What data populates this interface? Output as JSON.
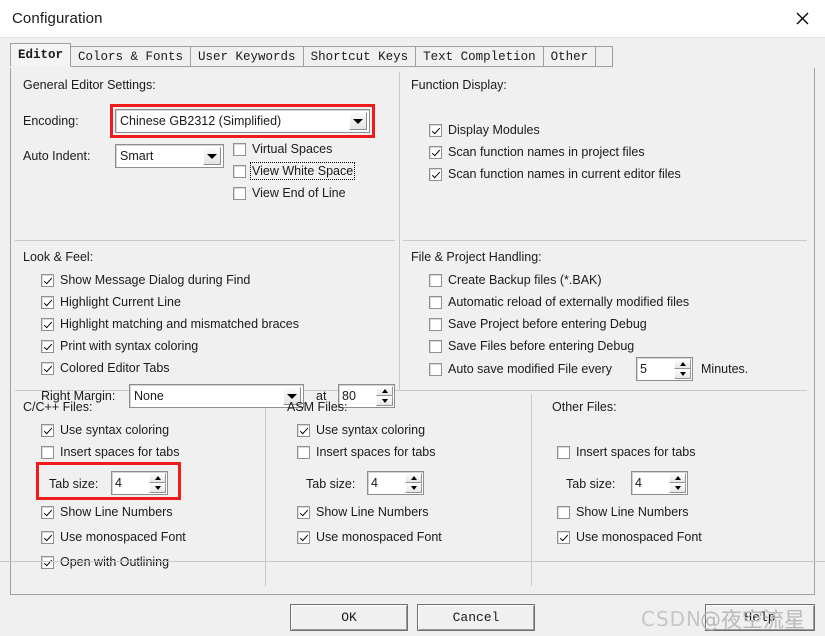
{
  "window": {
    "title": "Configuration",
    "close_icon": "close-icon"
  },
  "tabs": [
    {
      "label": "Editor",
      "selected": true
    },
    {
      "label": "Colors & Fonts",
      "selected": false
    },
    {
      "label": "User Keywords",
      "selected": false
    },
    {
      "label": "Shortcut Keys",
      "selected": false
    },
    {
      "label": "Text Completion",
      "selected": false
    },
    {
      "label": "Other",
      "selected": false
    }
  ],
  "general_editor": {
    "title": "General Editor Settings:",
    "encoding_label": "Encoding:",
    "encoding_value": "Chinese GB2312 (Simplified)",
    "auto_indent_label": "Auto Indent:",
    "auto_indent_value": "Smart",
    "checks": [
      {
        "label": "Virtual Spaces",
        "checked": false,
        "focused": false
      },
      {
        "label": "View White Space",
        "checked": false,
        "focused": true
      },
      {
        "label": "View End of Line",
        "checked": false,
        "focused": false
      }
    ]
  },
  "function_display": {
    "title": "Function Display:",
    "checks": [
      {
        "label": "Display Modules",
        "checked": true
      },
      {
        "label": "Scan function names in project files",
        "checked": true
      },
      {
        "label": "Scan function names in current editor files",
        "checked": true
      }
    ]
  },
  "look_feel": {
    "title": "Look & Feel:",
    "checks": [
      {
        "label": "Show Message Dialog during Find",
        "checked": true
      },
      {
        "label": "Highlight Current Line",
        "checked": true
      },
      {
        "label": "Highlight matching and mismatched braces",
        "checked": true
      },
      {
        "label": "Print with syntax coloring",
        "checked": true
      },
      {
        "label": "Colored Editor Tabs",
        "checked": true
      }
    ],
    "right_margin_label": "Right Margin:",
    "right_margin_value": "None",
    "at_label": "at",
    "at_value": "80"
  },
  "file_project": {
    "title": "File & Project Handling:",
    "checks": [
      {
        "label": "Create Backup files (*.BAK)",
        "checked": false
      },
      {
        "label": "Automatic reload of externally modified files",
        "checked": false
      },
      {
        "label": "Save Project before entering Debug",
        "checked": false
      },
      {
        "label": "Save Files before entering Debug",
        "checked": false
      },
      {
        "label": "Auto save modified File every",
        "checked": false
      }
    ],
    "autosave_value": "5",
    "minutes_label": "Minutes."
  },
  "cpp_files": {
    "title": "C/C++ Files:",
    "checks_top": [
      {
        "label": "Use syntax coloring",
        "checked": true
      },
      {
        "label": "Insert spaces for tabs",
        "checked": false
      }
    ],
    "tab_size_label": "Tab size:",
    "tab_size_value": "4",
    "checks_bottom": [
      {
        "label": "Show Line Numbers",
        "checked": true
      },
      {
        "label": "Use monospaced Font",
        "checked": true
      },
      {
        "label": "Open with Outlining",
        "checked": true
      }
    ]
  },
  "asm_files": {
    "title": "ASM Files:",
    "checks_top": [
      {
        "label": "Use syntax coloring",
        "checked": true
      },
      {
        "label": "Insert spaces for tabs",
        "checked": false
      }
    ],
    "tab_size_label": "Tab size:",
    "tab_size_value": "4",
    "checks_bottom": [
      {
        "label": "Show Line Numbers",
        "checked": true
      },
      {
        "label": "Use monospaced Font",
        "checked": true
      }
    ]
  },
  "other_files": {
    "title": "Other Files:",
    "checks_top": [
      {
        "label": "Insert spaces for tabs",
        "checked": false
      }
    ],
    "tab_size_label": "Tab size:",
    "tab_size_value": "4",
    "checks_bottom": [
      {
        "label": "Show Line Numbers",
        "checked": false
      },
      {
        "label": "Use monospaced Font",
        "checked": true
      }
    ]
  },
  "buttons": {
    "ok": "OK",
    "cancel": "Cancel",
    "help": "Help"
  },
  "watermark": {
    "brand": "CSDN",
    "user": "@夜空流星"
  },
  "colors": {
    "annotation": "#f01c1c",
    "dialog_bg": "#f0f0f0",
    "border": "#a0a0a0"
  }
}
